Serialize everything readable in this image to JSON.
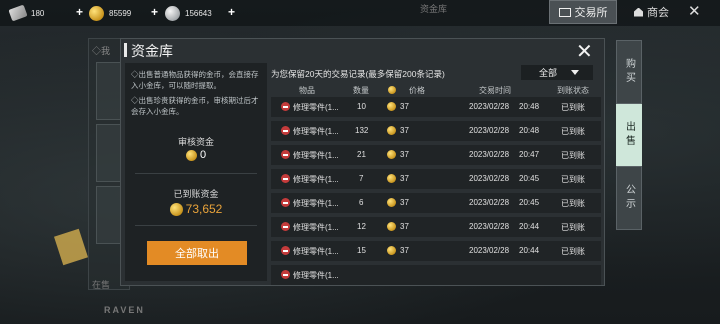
{
  "topbar": {
    "ticket_value": "180",
    "gold_value": "85599",
    "silver_value": "156643",
    "plus": "+",
    "vault_tab": "资金库",
    "exchange_label": "交易所",
    "store_label": "商会",
    "close": "✕"
  },
  "background": {
    "left_tab_fragment": "◇我",
    "bottom_fragment": "在售",
    "brand": "RAVEN"
  },
  "right_tabs": [
    {
      "label": "购买",
      "active": false
    },
    {
      "label": "出售",
      "active": true
    },
    {
      "label": "公示",
      "active": false
    }
  ],
  "modal": {
    "title": "资金库",
    "close": "✕",
    "notes": [
      "◇出售普通物品获得的金币，会直接存入小金库，可以随时提取。",
      "◇出售珍贵获得的金币，审核期过后才会存入小金库。"
    ],
    "review_label": "审核资金",
    "review_value": "0",
    "settled_label": "已到账资金",
    "settled_value": "73,652",
    "withdraw_label": "全部取出",
    "hint": "为您保留20天的交易记录(最多保留200条记录)",
    "filter_value": "全部",
    "columns": {
      "item": "物品",
      "qty": "数量",
      "price": "价格",
      "time": "交易时间",
      "status": "到账状态"
    },
    "rows": [
      {
        "item": "修理零件(1...",
        "qty": "10",
        "price": "37",
        "date": "2023/02/28",
        "time": "20:48",
        "status": "已到账"
      },
      {
        "item": "修理零件(1...",
        "qty": "132",
        "price": "37",
        "date": "2023/02/28",
        "time": "20:48",
        "status": "已到账"
      },
      {
        "item": "修理零件(1...",
        "qty": "21",
        "price": "37",
        "date": "2023/02/28",
        "time": "20:47",
        "status": "已到账"
      },
      {
        "item": "修理零件(1...",
        "qty": "7",
        "price": "37",
        "date": "2023/02/28",
        "time": "20:45",
        "status": "已到账"
      },
      {
        "item": "修理零件(1...",
        "qty": "6",
        "price": "37",
        "date": "2023/02/28",
        "time": "20:45",
        "status": "已到账"
      },
      {
        "item": "修理零件(1...",
        "qty": "12",
        "price": "37",
        "date": "2023/02/28",
        "time": "20:44",
        "status": "已到账"
      },
      {
        "item": "修理零件(1...",
        "qty": "15",
        "price": "37",
        "date": "2023/02/28",
        "time": "20:44",
        "status": "已到账"
      },
      {
        "item": "修理零件(1...",
        "qty": "",
        "price": "",
        "date": "",
        "time": "",
        "status": ""
      }
    ]
  },
  "colors": {
    "accent_orange": "#e38b25",
    "active_tab": "#cfe7da",
    "item_icon_red": "#c43b3b"
  }
}
